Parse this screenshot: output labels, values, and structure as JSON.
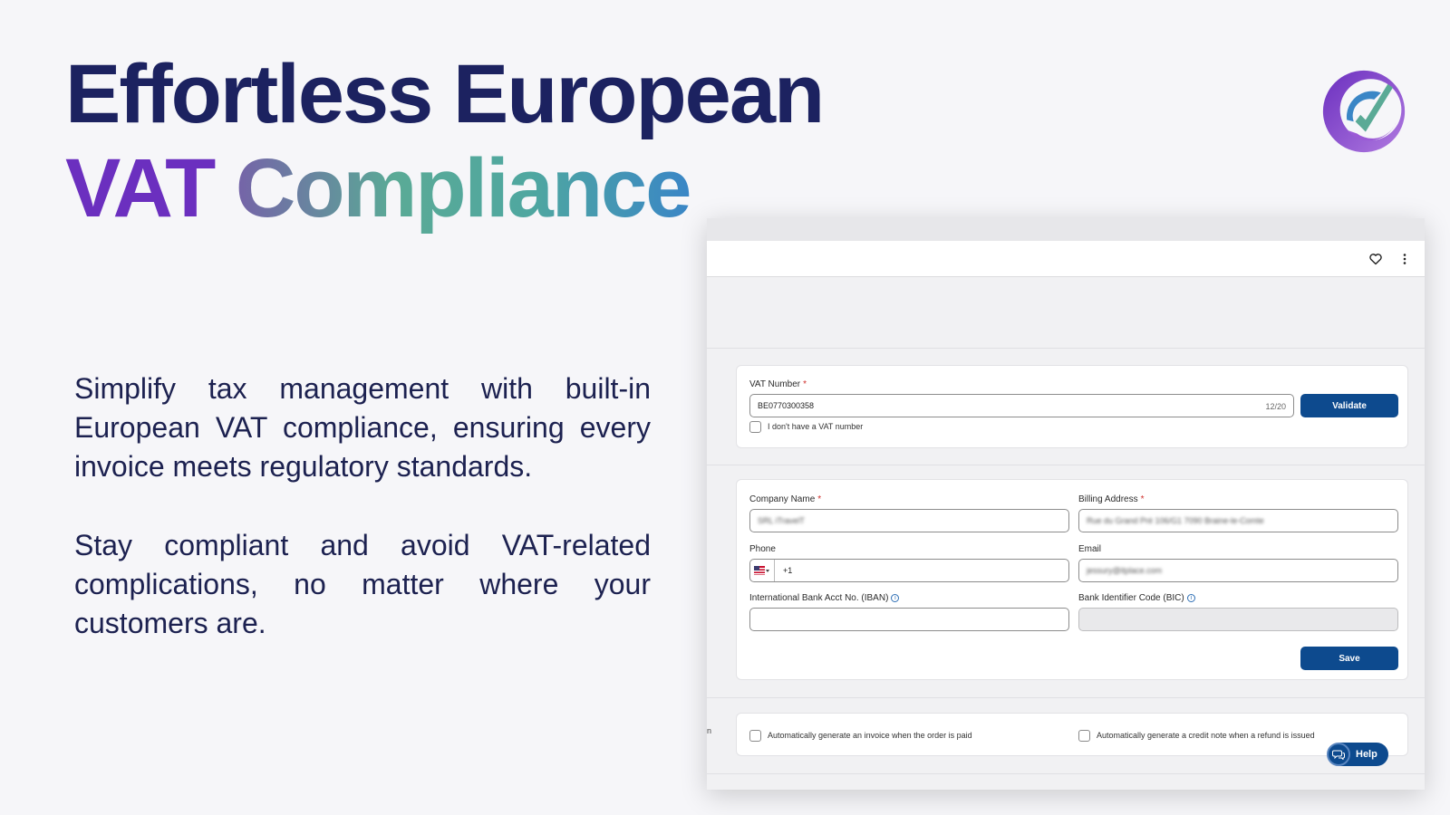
{
  "headline": {
    "line1": "Effortless European",
    "line2_part1": "VAT",
    "line2_part2": "Compliance"
  },
  "description": {
    "paragraph1": "Simplify tax management with built-in European VAT compliance, ensuring every invoice meets regulatory standards.",
    "paragraph2": "Stay compliant and avoid VAT-related complications, no matter where your customers are."
  },
  "logo": {
    "icon": "app-logo-checkmark-icon",
    "colors": [
      "#6b2fbf",
      "#9b5ad6",
      "#3a86c6",
      "#5aaa96"
    ]
  },
  "app": {
    "topbar": {
      "favorite_icon": "heart-icon",
      "menu_icon": "kebab-menu-icon"
    },
    "vat_section": {
      "vat_label": "VAT Number",
      "required_mark": "*",
      "vat_value": "BE0770300358",
      "char_counter": "12/20",
      "validate_label": "Validate",
      "no_vat_label": "I don't have a VAT number"
    },
    "company_section": {
      "company_name_label": "Company Name",
      "company_name_value": "SRL iTravelT",
      "billing_address_label": "Billing Address",
      "billing_address_value": "Rue du Grand Pré 106/G1 7090 Braine-le-Comte",
      "phone_label": "Phone",
      "phone_code": "+1",
      "email_label": "Email",
      "email_value": "jessury@itplace.com",
      "iban_label": "International Bank Acct No. (IBAN)",
      "iban_value": "",
      "bic_label": "Bank Identifier Code (BIC)",
      "bic_value": "",
      "info_glyph": "i",
      "save_label": "Save"
    },
    "automation_section": {
      "auto_invoice_label": "Automatically generate an invoice when the order is paid",
      "auto_credit_note_label": "Automatically generate a credit note when a refund is issued"
    },
    "edge_text": "n",
    "help_label": "Help",
    "accent_color": "#0d4a8e"
  }
}
